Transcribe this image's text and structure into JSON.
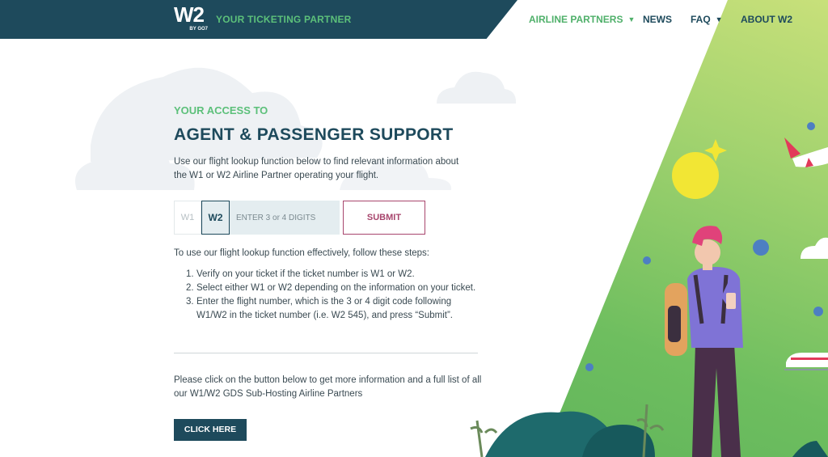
{
  "header": {
    "logo_text": "W2",
    "logo_sub": "BY GO7",
    "tagline": "YOUR TICKETING PARTNER"
  },
  "nav": {
    "items": [
      {
        "label": "AIRLINE PARTNERS",
        "has_dropdown": true,
        "active": true
      },
      {
        "label": "NEWS",
        "has_dropdown": false
      },
      {
        "label": "FAQ",
        "has_dropdown": true
      },
      {
        "label": "ABOUT W2",
        "has_dropdown": false
      }
    ]
  },
  "hero": {
    "eyebrow": "YOUR ACCESS TO",
    "title": "AGENT & PASSENGER SUPPORT",
    "intro": "Use our flight lookup function below to find relevant information about the W1 or W2 Airline Partner operating your flight."
  },
  "lookup": {
    "option_w1": "W1",
    "option_w2": "W2",
    "selected": "W2",
    "placeholder": "ENTER 3 or 4 DIGITS",
    "value": "",
    "submit_label": "SUBMIT"
  },
  "instructions": {
    "intro": "To use our flight lookup function effectively, follow these steps:",
    "steps": [
      {
        "num": "1.",
        "text": "Verify on your ticket if the ticket number is W1 or W2."
      },
      {
        "num": "2.",
        "text": "Select either W1 or W2 depending on the information on your ticket."
      },
      {
        "num": "3.",
        "text": "Enter the flight number, which is the 3 or 4 digit code following W1/W2 in the ticket number (i.e. W2 545), and press “Submit”."
      }
    ]
  },
  "more": {
    "text": "Please click on the button below to get more information and a full list of all our W1/W2 GDS Sub-Hosting Airline Partners",
    "button_label": "CLICK HERE"
  },
  "colors": {
    "navy": "#1e4a5c",
    "green": "#5cc07a",
    "magenta": "#a8466d"
  }
}
